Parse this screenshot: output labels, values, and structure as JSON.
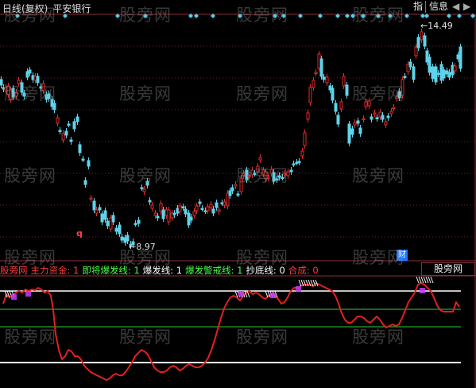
{
  "window": {
    "title_prefix": "日线(复权)",
    "stock_name": "平安银行",
    "btn_index": "指",
    "btn_info": "信息",
    "btn_prev": "◀",
    "btn_next": "▶"
  },
  "price_chart": {
    "high_label": "14.49",
    "low_label": "8.97",
    "signal_q": "q",
    "badge_cai": "财"
  },
  "indicator": {
    "name": "股旁网",
    "items": [
      {
        "label": "主力资金:",
        "value": "1",
        "color": "#ff3b3b"
      },
      {
        "label": "即将爆发线:",
        "value": "1",
        "color": "#44ff44"
      },
      {
        "label": "爆发线:",
        "value": "1",
        "color": "#ffffff"
      },
      {
        "label": "爆发警戒线:",
        "value": "1",
        "color": "#44ff44"
      },
      {
        "label": "抄底线:",
        "value": "0",
        "color": "#ffffff"
      },
      {
        "label": "合成:",
        "value": "0",
        "color": "#ff3b3b"
      }
    ],
    "tag_button": "股旁网",
    "main_line_color": "#e02020",
    "white_line_color": "#ffffff",
    "green_line_color": "#2ecc40"
  },
  "candle_colors": {
    "up": "#e02c2c",
    "down": "#5fd3ea"
  },
  "watermark": "股旁网"
}
